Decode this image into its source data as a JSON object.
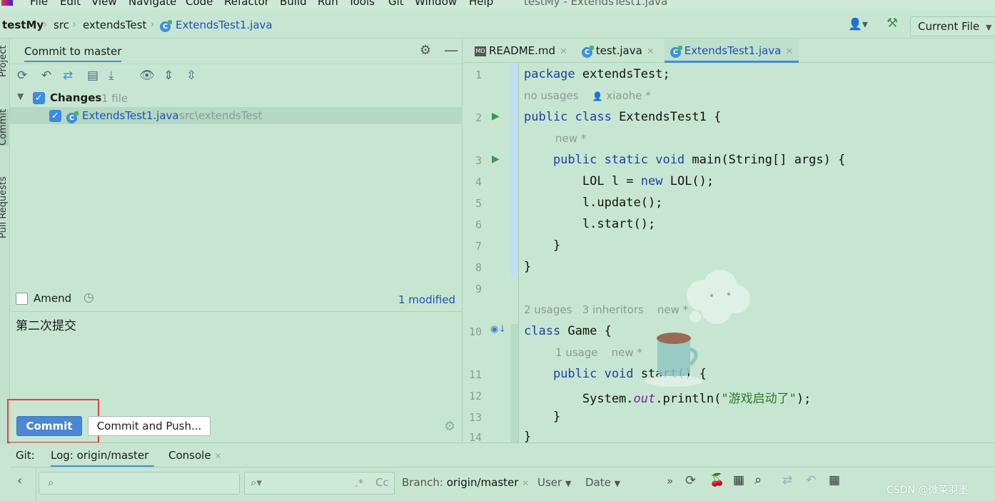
{
  "menu": {
    "items": [
      "File",
      "Edit",
      "View",
      "Navigate",
      "Code",
      "Refactor",
      "Build",
      "Run",
      "Tools",
      "Git",
      "Window",
      "Help"
    ],
    "window_title": "testMy - ExtendsTest1.java"
  },
  "navbar": {
    "breadcrumbs": [
      "testMy",
      "src",
      "extendsTest",
      "ExtendsTest1.java"
    ],
    "run_config": "Current File"
  },
  "sidebar_tabs": [
    "Project",
    "Commit",
    "Pull Requests"
  ],
  "commit_panel": {
    "header_title": "Commit to master",
    "changes_label": "Changes",
    "changes_count": "1 file",
    "file_name": "ExtendsTest1.java",
    "file_path": "src\\extendsTest",
    "amend_label": "Amend",
    "modified_link": "1 modified",
    "message": "第二次提交",
    "commit_button": "Commit",
    "commit_push_button": "Commit and Push..."
  },
  "editor": {
    "tabs": [
      {
        "label": "README.md",
        "icon": "markdown-icon"
      },
      {
        "label": "test.java",
        "icon": "java-class-icon"
      },
      {
        "label": "ExtendsTest1.java",
        "icon": "java-class-icon"
      }
    ],
    "line_numbers": [
      "1",
      "2",
      "3",
      "4",
      "5",
      "6",
      "7",
      "8",
      "9",
      "10",
      "11",
      "12",
      "13",
      "14"
    ],
    "code": {
      "l1_kw": "package",
      "l1_rest": " extendsTest;",
      "hint1a": "no usages",
      "hint1b": "xiaohe *",
      "l2_kw": "public class",
      "l2_rest": " ExtendsTest1 {",
      "hint2": "new *",
      "l3_kw": "    public static void",
      "l3_rest": " main(String[] args) {",
      "l4_a": "        LOL l = ",
      "l4_kw": "new",
      "l4_b": " LOL();",
      "l5": "        l.update();",
      "l6": "        l.start();",
      "l7": "    }",
      "l8": "}",
      "hint3a": "2 usages",
      "hint3b": "3 inheritors",
      "hint3c": "new *",
      "l10_kw": "class",
      "l10_rest": " Game {",
      "hint4a": "1 usage",
      "hint4b": "new *",
      "l11_kw": "    public void",
      "l11_rest": " start() {",
      "l12_a": "        System.",
      "l12_fld": "out",
      "l12_b": ".println(",
      "l12_str": "\"游戏启动了\"",
      "l12_c": ");",
      "l13": "    }",
      "l14": "}"
    }
  },
  "bottom": {
    "git_label": "Git:",
    "tabs": [
      "Log: origin/master",
      "Console"
    ],
    "branch_label": "Branch:",
    "branch_value": "origin/master",
    "user_filter": "User",
    "date_filter": "Date",
    "regex_label": ".*",
    "case_label": "Cc"
  },
  "watermark": "CSDN @微菜羽墨"
}
